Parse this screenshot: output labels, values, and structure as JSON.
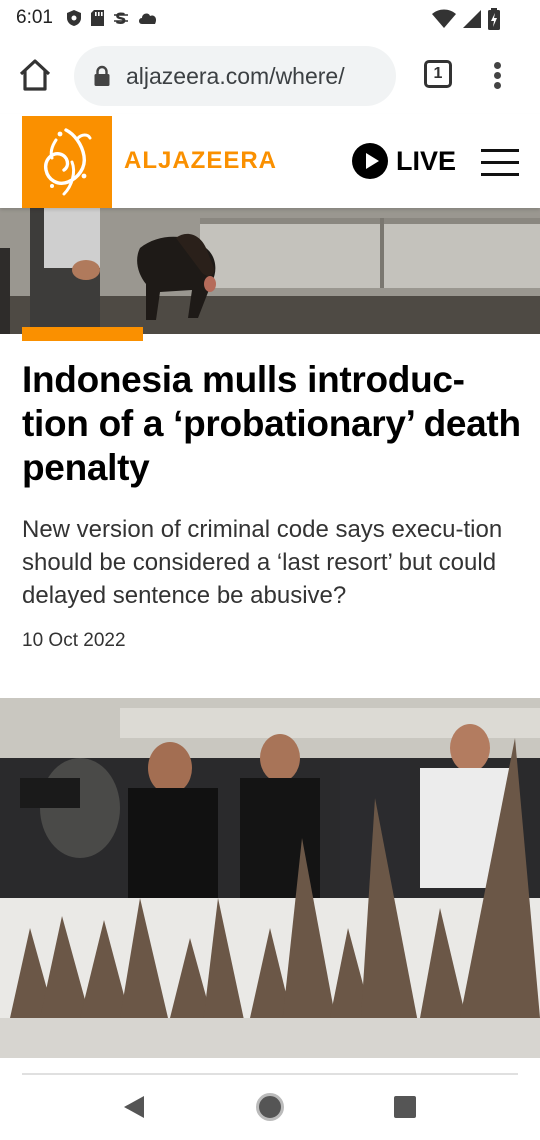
{
  "status_bar": {
    "time": "6:01",
    "left_icons": [
      "shield-icon",
      "sd-card-icon",
      "s-icon",
      "cloud-icon"
    ],
    "right_icons": [
      "wifi-icon",
      "signal-icon",
      "battery-icon"
    ]
  },
  "browser": {
    "url": "aljazeera.com/where/",
    "tab_count": "1"
  },
  "site": {
    "brand": "ALJAZEERA",
    "live_label": "LIVE",
    "brand_color": "#fa9000"
  },
  "article": {
    "title": "Indonesia mulls introduc-tion of a ‘probationary’ death penalty",
    "summary": "New version of criminal code says execu-tion should be considered a ‘last resort’ but could delayed sentence be abusive?",
    "date": "10 Oct 2022"
  }
}
